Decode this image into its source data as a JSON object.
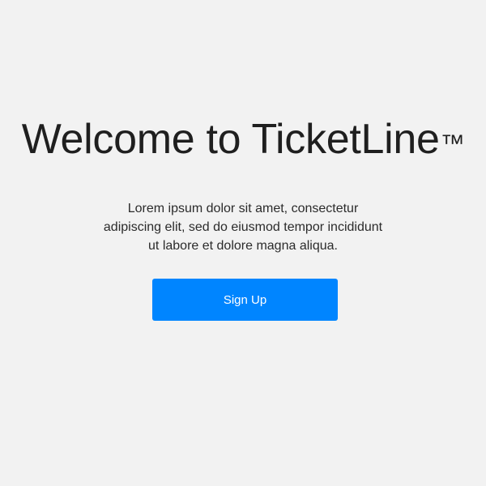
{
  "welcome": {
    "title": "Welcome to TicketLine",
    "trademark": "™",
    "body": "Lorem ipsum dolor sit amet, consectetur adipiscing elit, sed do eiusmod tempor incididunt ut labore et dolore magna aliqua.",
    "signup_label": "Sign Up"
  },
  "colors": {
    "background": "#f2f2f2",
    "text": "#1f1f1f",
    "button": "#0085ff",
    "button_text": "#ffffff"
  }
}
